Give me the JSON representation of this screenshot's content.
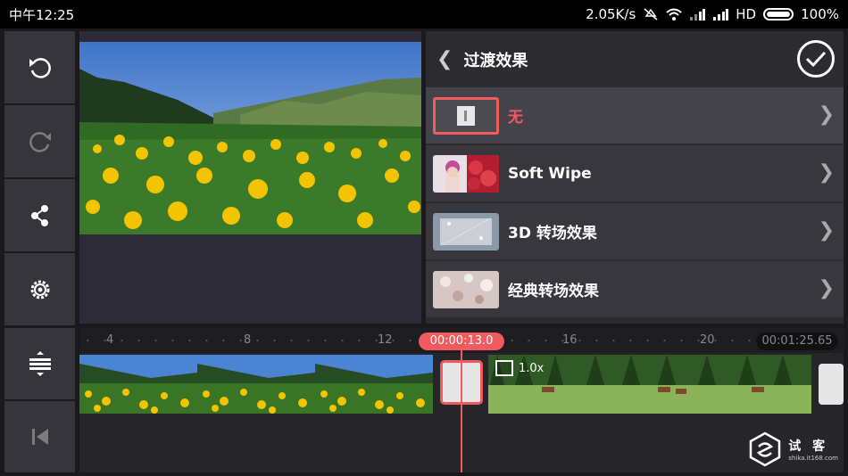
{
  "status": {
    "time": "中午12:25",
    "speed": "2.05K/s",
    "network": "HD",
    "battery": "100%"
  },
  "icons": {
    "undo": "undo-icon",
    "redo": "redo-icon",
    "share": "share-icon",
    "settings": "gear-icon",
    "adjust": "track-adjust-icon",
    "jump_start": "skip-start-icon"
  },
  "panel": {
    "title": "过渡效果",
    "items": [
      {
        "label": "无",
        "selected": true
      },
      {
        "label": "Soft Wipe",
        "selected": false
      },
      {
        "label": "3D 转场效果",
        "selected": false
      },
      {
        "label": "经典转场效果",
        "selected": false
      }
    ]
  },
  "timeline": {
    "ruler_ticks": [
      "4",
      "8",
      "12",
      "16",
      "20"
    ],
    "current_time": "00:00:13.0",
    "total_time": "00:01:25.65",
    "clip2_speed": "1.0x"
  },
  "watermark": {
    "text": "试 客",
    "sub": "shika.it168.com"
  },
  "colors": {
    "accent": "#f15a5e",
    "panel": "#2b2b30",
    "row": "#38373e"
  }
}
